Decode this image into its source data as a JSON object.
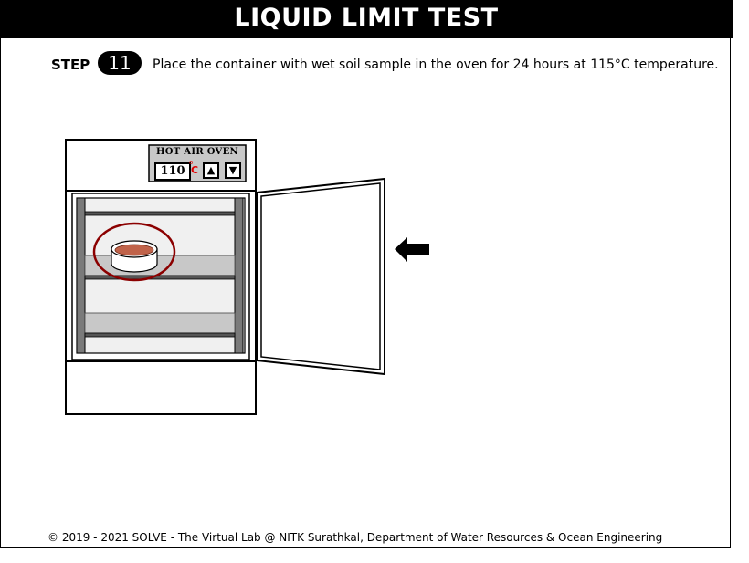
{
  "header": {
    "title": "LIQUID LIMIT TEST"
  },
  "step": {
    "label": "STEP",
    "number": "11",
    "instruction": "Place the container with wet soil sample in the oven for 24 hours at 115°C temperature."
  },
  "oven": {
    "panel_title": "HOT AIR OVEN",
    "temperature": "110",
    "unit_degree": "o",
    "unit_letter": "C",
    "up_symbol": "▲",
    "down_symbol": "▼"
  },
  "colors": {
    "header_bg": "#000000",
    "soil": "#c0634a",
    "highlight_ring": "#8b0000",
    "shelf_band": "#c8c8c8",
    "unit_red": "#e00000"
  },
  "icons": {
    "door_arrow": "arrow-left-icon",
    "up": "triangle-up-icon",
    "down": "triangle-down-icon"
  },
  "footer": {
    "text": "© 2019 - 2021 SOLVE - The Virtual Lab @ NITK Surathkal, Department of Water Resources & Ocean Engineering"
  }
}
